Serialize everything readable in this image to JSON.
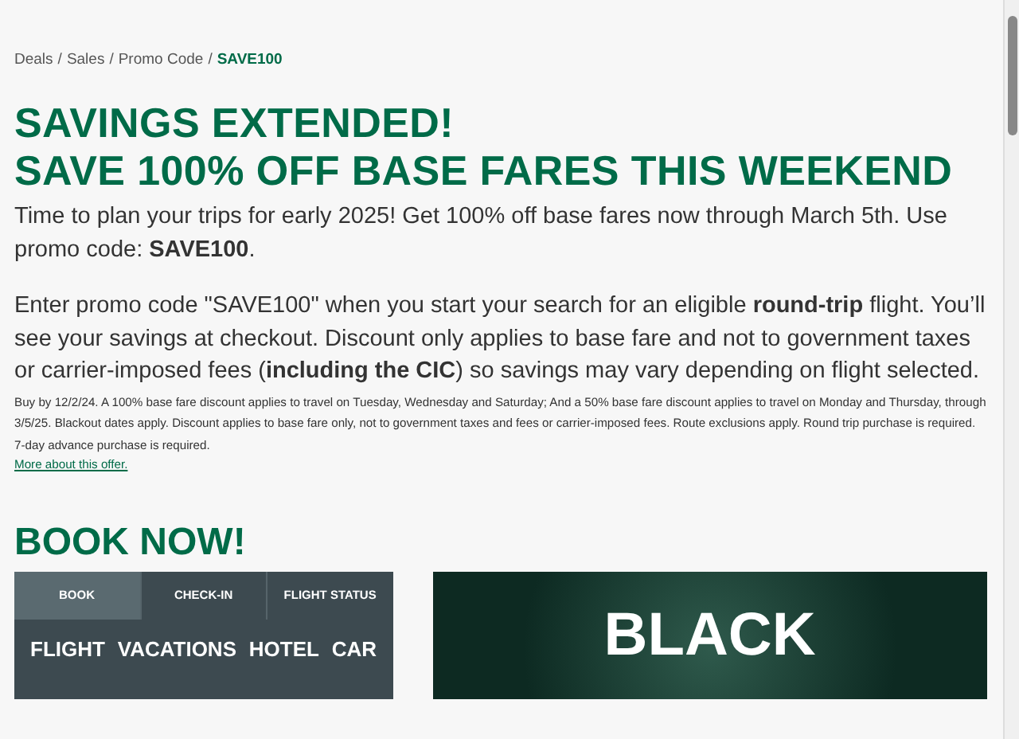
{
  "breadcrumb": [
    {
      "label": "Deals",
      "current": false
    },
    {
      "label": "Sales",
      "current": false
    },
    {
      "label": "Promo Code",
      "current": false
    },
    {
      "label": "SAVE100",
      "current": true
    }
  ],
  "separator": "/",
  "headline": [
    "SAVINGS EXTENDED!",
    "SAVE 100% OFF BASE FARES THIS WEEKEND"
  ],
  "intro": "Time to plan your trips for early 2025! Get 100% off base fares now through March 5th. Use promo code: **SAVE100**.",
  "details": "Enter promo code \"SAVE100\" when you start your search for an eligible **round-trip** flight. You’ll see your savings at checkout. Discount only applies to base fare and not to government taxes or carrier-imposed fees (**including the CIC**) so savings may vary depending on flight selected.",
  "fine_print": "Buy by 12/2/24. A 100% base fare discount applies to travel on Tuesday, Wednesday and Saturday; And a 50% base fare discount applies to travel on Monday and Thursday, through 3/5/25. Blackout dates apply. Discount applies to base fare only, not to government taxes and fees or carrier-imposed fees.  Route exclusions apply. Round trip purchase is required. 7-day advance purchase is required.",
  "more_link": "More about this offer.",
  "book_heading": "BOOK NOW!",
  "booking_tabs": [
    {
      "label": "BOOK",
      "selected": true
    },
    {
      "label": "CHECK-IN",
      "selected": false
    },
    {
      "label": "FLIGHT STATUS",
      "selected": false
    }
  ],
  "booking_types": [
    "FLIGHT",
    "VACATIONS",
    "HOTEL",
    "CAR"
  ],
  "banner": {
    "text": "BLACK"
  }
}
